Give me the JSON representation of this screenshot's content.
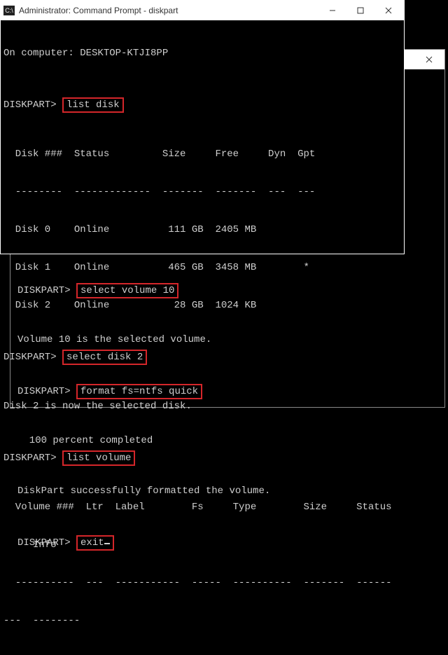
{
  "front": {
    "title": "Administrator: Command Prompt - diskpart",
    "icon": "C:\\",
    "btn": {
      "min": "–",
      "max": "▢",
      "close": "✕"
    },
    "lines": {
      "computer": "On computer: DESKTOP-KTJI8PP",
      "prompt": "DISKPART>",
      "cmd_list_disk": "list disk",
      "hdr_disk": "  Disk ###  Status         Size     Free     Dyn  Gpt",
      "sep_disk": "  --------  -------------  -------  -------  ---  ---",
      "row_d0": "  Disk 0    Online          111 GB  2405 MB",
      "row_d1": "  Disk 1    Online          465 GB  3458 MB        *",
      "row_d2": "  Disk 2    Online           28 GB  1024 KB",
      "cmd_select_disk": "select disk 2",
      "msg_sel_disk": "Disk 2 is now the selected disk.",
      "cmd_list_vol": "list volume",
      "hdr_vol1": "  Volume ###  Ltr  Label        Fs     Type        Size     Status",
      "hdr_vol2": "     Info",
      "sep_vol1": "  ----------  ---  -----------  -----  ----------  -------  ------",
      "sep_vol2": "---  --------"
    }
  },
  "back": {
    "titlebar_visible": true,
    "btn": {
      "min": "–",
      "max": "▢",
      "close": "✕"
    },
    "lines": {
      "prompt": "DISKPART>",
      "cmd_sel_vol": "select volume 10",
      "msg_sel_vol": "Volume 10 is the selected volume.",
      "cmd_format": "format fs=ntfs quick",
      "msg_pct": "  100 percent completed",
      "msg_done": "DiskPart successfully formatted the volume.",
      "cmd_exit": "exit"
    }
  }
}
